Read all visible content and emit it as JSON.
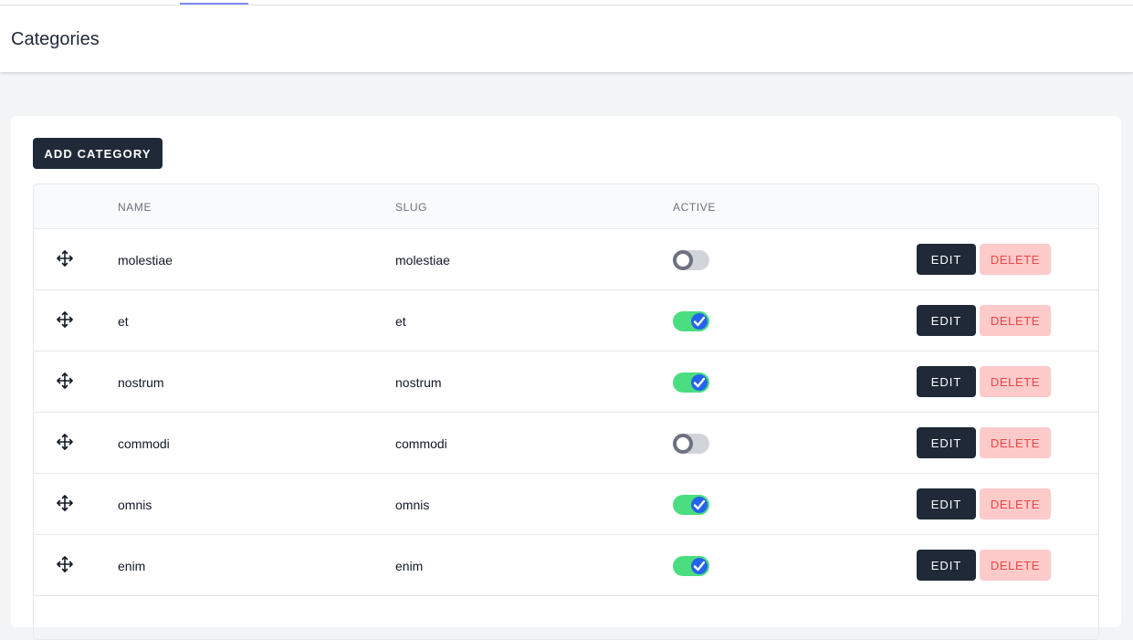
{
  "page": {
    "title": "Categories"
  },
  "toolbar": {
    "add_label": "ADD CATEGORY"
  },
  "table": {
    "columns": {
      "name": "NAME",
      "slug": "SLUG",
      "active": "ACTIVE"
    },
    "actions": {
      "edit_label": "EDIT",
      "delete_label": "DELETE"
    },
    "rows": [
      {
        "name": "molestiae",
        "slug": "molestiae",
        "active": false
      },
      {
        "name": "et",
        "slug": "et",
        "active": true
      },
      {
        "name": "nostrum",
        "slug": "nostrum",
        "active": true
      },
      {
        "name": "commodi",
        "slug": "commodi",
        "active": false
      },
      {
        "name": "omnis",
        "slug": "omnis",
        "active": true
      },
      {
        "name": "enim",
        "slug": "enim",
        "active": true
      }
    ]
  },
  "icons": {
    "drag": "drag-move-icon",
    "check": "checkmark-icon"
  },
  "colors": {
    "primary": "#1f2937",
    "toggle_on": "#4ade80",
    "toggle_off": "#d1d5db",
    "check_knob": "#2563eb",
    "delete_bg": "#fecaca",
    "delete_text": "#ef4444",
    "nav_indicator": "#818cf8"
  }
}
